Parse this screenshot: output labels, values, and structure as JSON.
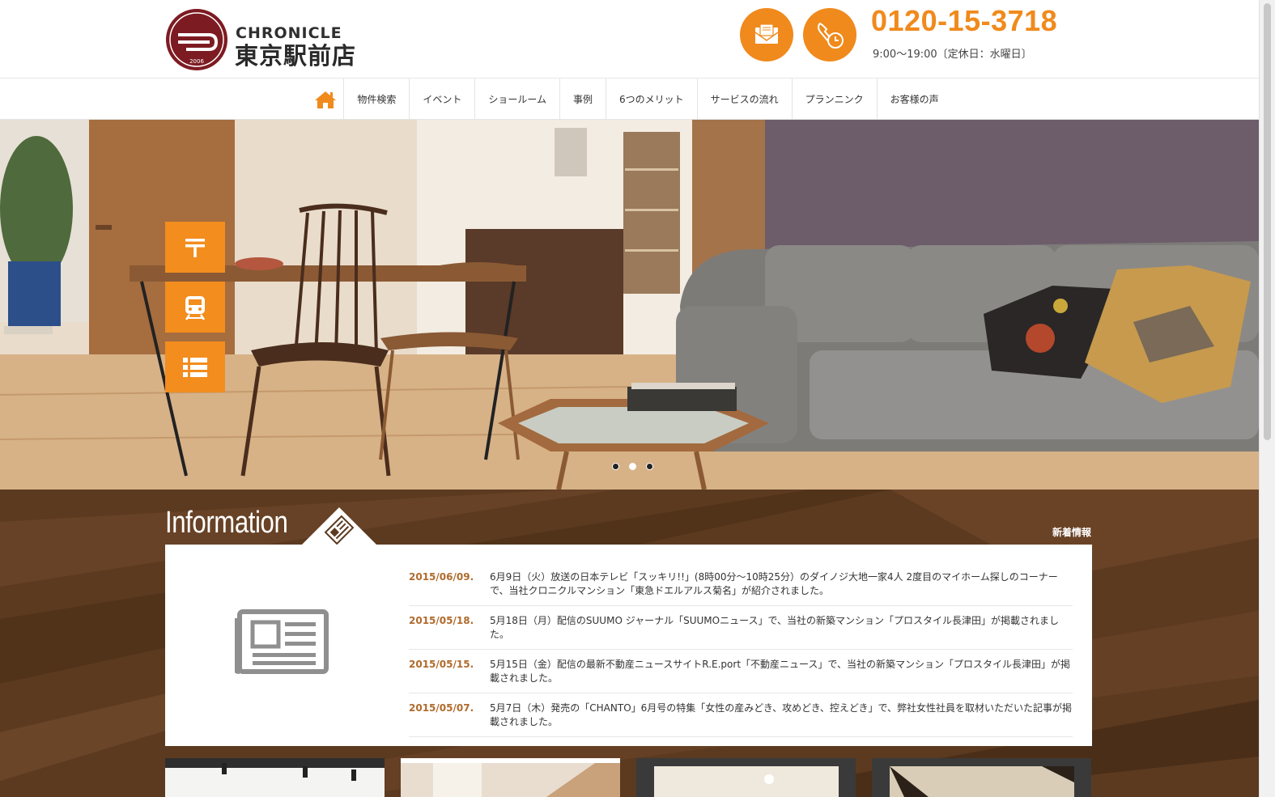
{
  "brand": {
    "logo_en": "CHRONICLE",
    "logo_jp": "東京駅前店",
    "logo_year": "2006",
    "primary_color": "#f08a1c",
    "logo_color": "#7d1b22"
  },
  "contact": {
    "mail_icon": "envelope-icon",
    "phone_icon": "phone-clock-icon",
    "phone_number": "0120-15-3718",
    "hours": "9:00〜19:00〔定休日：水曜日〕"
  },
  "nav": {
    "home_icon": "home-icon",
    "items": [
      {
        "label": "物件検索"
      },
      {
        "label": "イベント"
      },
      {
        "label": "ショールーム"
      },
      {
        "label": "事例"
      },
      {
        "label": "6つのメリット"
      },
      {
        "label": "サービスの流れ"
      },
      {
        "label": "プランニンク"
      },
      {
        "label": "お客様の声"
      }
    ]
  },
  "hero": {
    "side_buttons": [
      {
        "icon": "postal-mark-icon"
      },
      {
        "icon": "train-icon"
      },
      {
        "icon": "list-icon"
      }
    ],
    "slides": 3,
    "active_slide": 2
  },
  "information": {
    "title": "Information",
    "subtitle": "新着情報",
    "icon": "newspaper-icon",
    "news": [
      {
        "date": "2015/06/09.",
        "text": "6月9日（火）放送の日本テレビ「スッキリ!!」(8時00分〜10時25分）のダイノジ大地一家4人 2度目のマイホーム探しのコーナーで、当社クロニクルマンション「東急ドエルアルス菊名」が紹介されました。"
      },
      {
        "date": "2015/05/18.",
        "text": "5月18日（月）配信のSUUMO ジャーナル「SUUMOニュース」で、当社の新築マンション「プロスタイル長津田」が掲載されました。"
      },
      {
        "date": "2015/05/15.",
        "text": "5月15日（金）配信の最新不動産ニュースサイトR.E.port「不動産ニュース」で、当社の新築マンション「プロスタイル長津田」が掲載されました。"
      },
      {
        "date": "2015/05/07.",
        "text": "5月7日（木）発売の「CHANTO」6月号の特集「女性の産みどき、攻めどき、控えどき」で、弊社女性社員を取材いただいた記事が掲載されました。"
      }
    ]
  }
}
